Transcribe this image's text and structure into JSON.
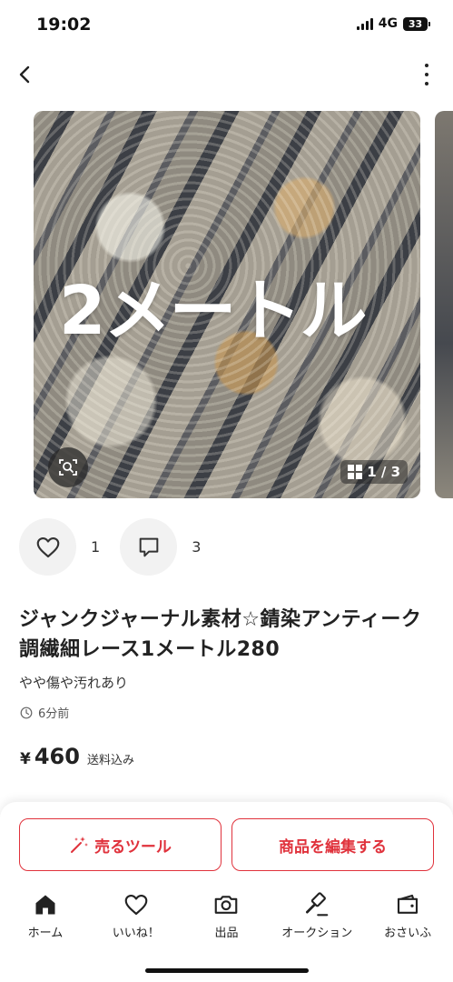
{
  "status_bar": {
    "time": "19:02",
    "network": "4G",
    "battery": "33"
  },
  "nav": {
    "back_icon": "chevron-left-icon",
    "more_icon": "more-vertical-icon"
  },
  "gallery": {
    "overlay_text": "2メートル",
    "counter": "1 / 3",
    "current_index": 1,
    "total": 3
  },
  "actions": {
    "like_count": "1",
    "comment_count": "3"
  },
  "item": {
    "title": "ジャンクジャーナル素材☆錆染アンティーク調繊細レース1メートル280",
    "condition": "やや傷や汚れあり",
    "posted": "6分前",
    "currency": "¥",
    "price": "460",
    "shipping": "送料込み"
  },
  "buttons": {
    "sell_tool": "売るツール",
    "edit_item": "商品を編集する"
  },
  "tabs": [
    {
      "label": "ホーム",
      "icon": "home-icon"
    },
    {
      "label": "いいね！",
      "icon": "heart-icon"
    },
    {
      "label": "出品",
      "icon": "camera-icon"
    },
    {
      "label": "オークション",
      "icon": "gavel-icon"
    },
    {
      "label": "おさいふ",
      "icon": "wallet-icon"
    }
  ],
  "colors": {
    "accent": "#e0323c",
    "text": "#222222"
  }
}
